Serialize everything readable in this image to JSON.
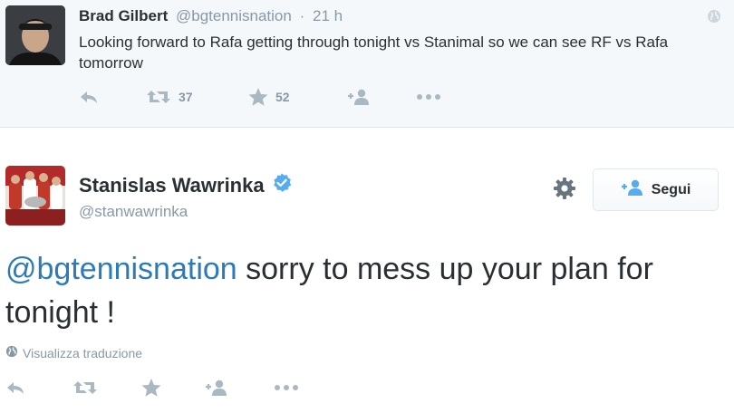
{
  "parent_tweet": {
    "author_name": "Brad Gilbert",
    "handle": "@bgtennisnation",
    "separator": "·",
    "time": "21 h",
    "text": "Looking forward to Rafa getting through tonight vs Stanimal so we can see RF vs Rafa tomorrow",
    "actions": {
      "reply_icon": "reply-icon",
      "retweet_icon": "retweet-icon",
      "retweet_count": "37",
      "favorite_icon": "star-icon",
      "favorite_count": "52",
      "follow_icon": "follow-user-icon",
      "more_icon": "more-icon"
    }
  },
  "main_tweet": {
    "author_name": "Stanislas Wawrinka",
    "verified_icon": "verified-badge-icon",
    "handle": "@stanwawrinka",
    "settings_icon": "gear-icon",
    "follow_button_label": "Segui",
    "text_mention": "@bgtennisnation",
    "text_body": " sorry to mess up your plan for tonight !",
    "translate_label": "Visualizza traduzione",
    "translate_icon": "globe-icon",
    "actions": {
      "reply_icon": "reply-icon",
      "retweet_icon": "retweet-icon",
      "favorite_icon": "star-icon",
      "follow_icon": "follow-user-icon",
      "more_icon": "more-icon"
    }
  },
  "colors": {
    "accent_link": "#2b7bb9",
    "verified": "#55acee",
    "muted": "#8899a6",
    "icon": "#aab8c2",
    "parent_background": "#f5f8fa"
  }
}
